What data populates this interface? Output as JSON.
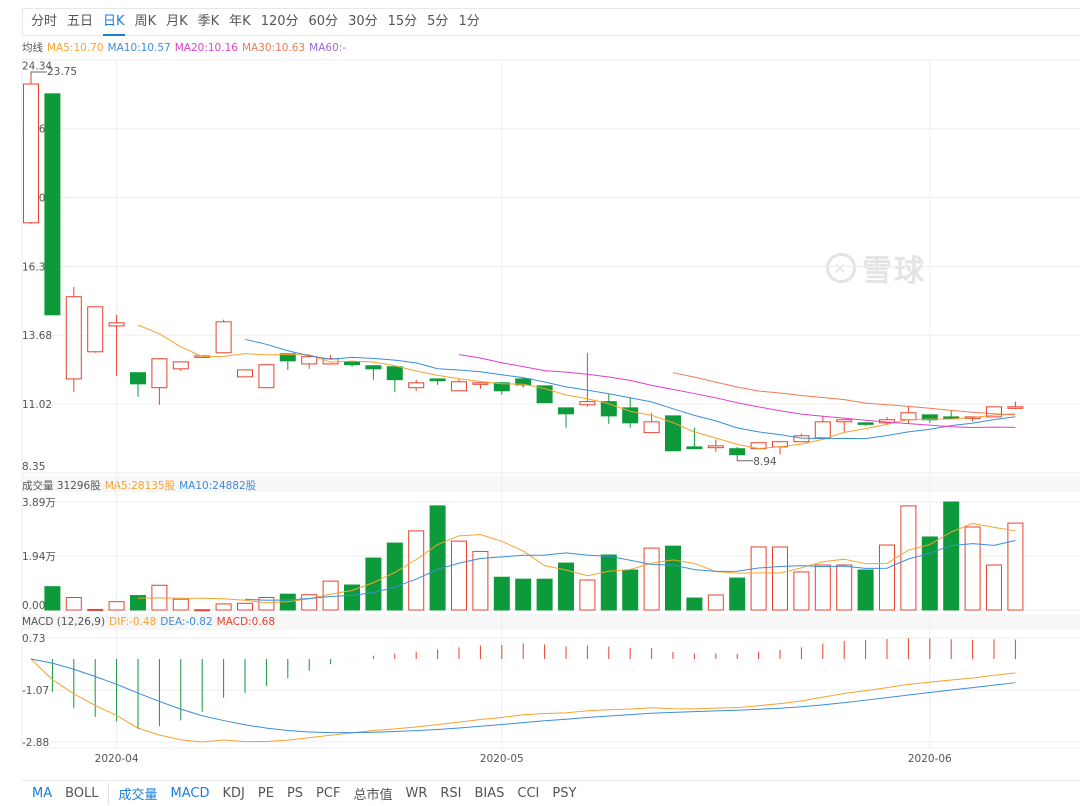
{
  "period_tabs": [
    "分时",
    "五日",
    "日K",
    "周K",
    "月K",
    "季K",
    "年K",
    "120分",
    "60分",
    "30分",
    "15分",
    "5分",
    "1分"
  ],
  "active_period": "日K",
  "ma_legend": {
    "label": "均线",
    "ma5": "MA5:10.70",
    "ma10": "MA10:10.57",
    "ma20": "MA20:10.16",
    "ma30": "MA30:10.63",
    "ma60": "MA60:-"
  },
  "volume_legend": {
    "label": "成交量 31296股",
    "ma5": "MA5:28135股",
    "ma10": "MA10:24882股"
  },
  "macd_legend": {
    "label": "MACD (12,26,9)",
    "dif": "DIF:-0.48",
    "dea": "DEA:-0.82",
    "macd": "MACD:0.68"
  },
  "watermark": "雪球",
  "indicator_tabs": [
    "MA",
    "BOLL",
    "成交量",
    "MACD",
    "KDJ",
    "PE",
    "PS",
    "PCF",
    "总市值",
    "WR",
    "RSI",
    "BIAS",
    "CCI",
    "PSY"
  ],
  "active_indicators": [
    "MA",
    "成交量",
    "MACD"
  ],
  "colors": {
    "up": "#e8412f",
    "down": "#0d9a3a",
    "ma5": "#f5a330",
    "ma10": "#3b8ede",
    "ma20": "#e040c8",
    "ma30": "#f27a52",
    "ma60": "#9a6ad6",
    "accent": "#1a7ed8"
  },
  "chart_data": [
    {
      "type": "candlestick",
      "ylim": [
        8.35,
        24.34
      ],
      "y_ticks": [
        "24.34",
        "21.67",
        "19.01",
        "16.34",
        "13.68",
        "11.02",
        "8.35"
      ],
      "annotations": {
        "high": "23.75",
        "low": "8.94"
      },
      "x_ticks": [
        {
          "label": "2020-04",
          "index": 4
        },
        {
          "label": "2020-05",
          "index": 22
        },
        {
          "label": "2020-06",
          "index": 42
        }
      ],
      "ohlc": [
        [
          18.03,
          23.4,
          23.75,
          17.99
        ],
        [
          23.02,
          14.47,
          23.02,
          14.47
        ],
        [
          11.99,
          15.17,
          15.55,
          11.49
        ],
        [
          13.04,
          14.78,
          14.78,
          13.0
        ],
        [
          14.04,
          14.16,
          14.47,
          12.11
        ],
        [
          12.23,
          11.8,
          12.23,
          11.3
        ],
        [
          11.65,
          12.77,
          12.77,
          10.99
        ],
        [
          12.38,
          12.65,
          12.65,
          12.3
        ],
        [
          12.85,
          12.88,
          12.88,
          12.85
        ],
        [
          13.0,
          14.2,
          14.28,
          13.0
        ],
        [
          12.07,
          12.34,
          12.34,
          12.07
        ],
        [
          11.65,
          12.54,
          12.54,
          11.65
        ],
        [
          12.96,
          12.69,
          12.96,
          12.34
        ],
        [
          12.57,
          12.85,
          12.92,
          12.38
        ],
        [
          12.57,
          12.77,
          12.92,
          12.57
        ],
        [
          12.65,
          12.54,
          12.65,
          12.46
        ],
        [
          12.5,
          12.38,
          12.5,
          11.96
        ],
        [
          12.46,
          11.96,
          12.46,
          11.49
        ],
        [
          11.65,
          11.84,
          11.96,
          11.53
        ],
        [
          11.99,
          11.92,
          11.99,
          11.76
        ],
        [
          11.53,
          11.88,
          11.99,
          11.53
        ],
        [
          11.8,
          11.84,
          11.84,
          11.61
        ],
        [
          11.84,
          11.53,
          11.84,
          11.38
        ],
        [
          11.99,
          11.76,
          12.03,
          11.65
        ],
        [
          11.72,
          11.07,
          11.72,
          11.07
        ],
        [
          10.87,
          10.64,
          10.87,
          10.1
        ],
        [
          10.99,
          11.11,
          13.0,
          10.91
        ],
        [
          11.11,
          10.56,
          11.42,
          10.25
        ],
        [
          10.87,
          10.29,
          11.26,
          10.1
        ],
        [
          9.91,
          10.33,
          10.68,
          9.91
        ],
        [
          10.56,
          9.21,
          10.56,
          9.21
        ],
        [
          9.36,
          9.29,
          10.1,
          9.29
        ],
        [
          9.33,
          9.4,
          9.64,
          9.17
        ],
        [
          9.29,
          9.06,
          9.36,
          8.94
        ],
        [
          9.29,
          9.52,
          9.52,
          9.29
        ],
        [
          9.36,
          9.56,
          9.56,
          9.06
        ],
        [
          9.56,
          9.79,
          9.87,
          9.56
        ],
        [
          9.71,
          10.33,
          10.56,
          9.71
        ],
        [
          10.33,
          10.41,
          10.41,
          9.95
        ],
        [
          10.29,
          10.25,
          10.29,
          10.18
        ],
        [
          10.29,
          10.41,
          10.52,
          10.21
        ],
        [
          10.41,
          10.68,
          10.95,
          10.25
        ],
        [
          10.6,
          10.41,
          10.6,
          10.29
        ],
        [
          10.52,
          10.45,
          10.75,
          10.45
        ],
        [
          10.48,
          10.52,
          10.52,
          10.33
        ],
        [
          10.52,
          10.91,
          10.91,
          10.52
        ],
        [
          10.91,
          10.91,
          11.11,
          10.83
        ]
      ]
    },
    {
      "type": "bar",
      "unit": "万股",
      "ylim": [
        0,
        3.89
      ],
      "y_ticks": [
        "3.89万",
        "1.94万",
        "0.00"
      ],
      "values": [
        null,
        0.84,
        0.45,
        0.02,
        0.3,
        0.52,
        0.89,
        0.39,
        0.01,
        0.22,
        0.24,
        0.45,
        0.57,
        0.55,
        1.04,
        0.9,
        1.87,
        2.41,
        2.85,
        3.75,
        2.48,
        2.11,
        1.18,
        1.11,
        1.11,
        1.69,
        1.08,
        1.98,
        1.44,
        2.23,
        2.3,
        0.43,
        0.54,
        1.15,
        2.27,
        2.27,
        1.37,
        1.62,
        1.62,
        1.44,
        2.34,
        3.75,
        2.63,
        3.89,
        2.99,
        1.62,
        3.13
      ]
    },
    {
      "type": "line",
      "indicator": "MACD (12,26,9)",
      "ylim": [
        -2.88,
        0.73
      ],
      "y_ticks": [
        "0.73",
        "-1.07",
        "-2.88"
      ]
    }
  ]
}
